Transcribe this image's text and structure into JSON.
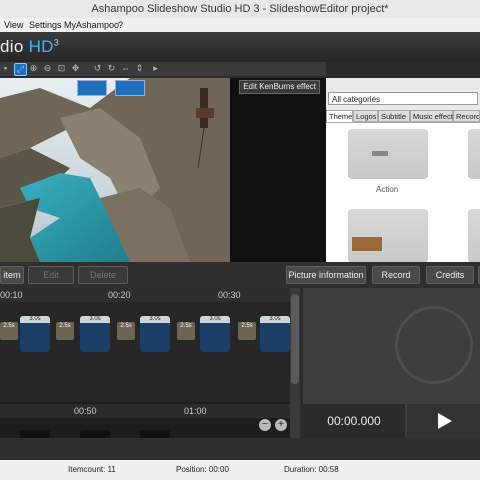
{
  "window": {
    "title": "Ashampoo Slideshow Studio HD 3 - SlideshowEditor project*"
  },
  "menu": {
    "items": [
      "View",
      "Settings",
      "MyAshampoo",
      "?"
    ]
  },
  "header": {
    "title_prefix": "dio ",
    "title_hd": "HD",
    "title_version": "3"
  },
  "preview": {
    "effect_button": "Edit KenBurns effect"
  },
  "panel": {
    "category_select": "All categories",
    "tabs": [
      "Theme",
      "Logos",
      "Subtitle",
      "Music effect",
      "Recordi"
    ],
    "tiles": [
      {
        "label": "Action"
      }
    ]
  },
  "actions": {
    "buttons": [
      "item",
      "Edit",
      "Delete",
      "Picture information",
      "Record",
      "Credits"
    ]
  },
  "timeline": {
    "ruler_top": [
      "00:10",
      "00:20",
      "00:30"
    ],
    "ruler_bottom": [
      "00:50",
      "01:00"
    ],
    "durations": [
      "2.5s",
      "3.0s",
      "2.5s",
      "3.0s",
      "2.5s",
      "3.0s",
      "2.5s",
      "3.0s",
      "2.5s",
      "3.0s"
    ],
    "zoom_out": "−",
    "zoom_in": "+"
  },
  "player": {
    "timecode": "00:00.000"
  },
  "status": {
    "itemcount": "Itemcount: 11",
    "position": "Position: 00:00",
    "duration": "Duration: 00:58"
  },
  "colors": {
    "accent": "#3db3ff",
    "toolbar_bg": "#3a3a3a"
  }
}
